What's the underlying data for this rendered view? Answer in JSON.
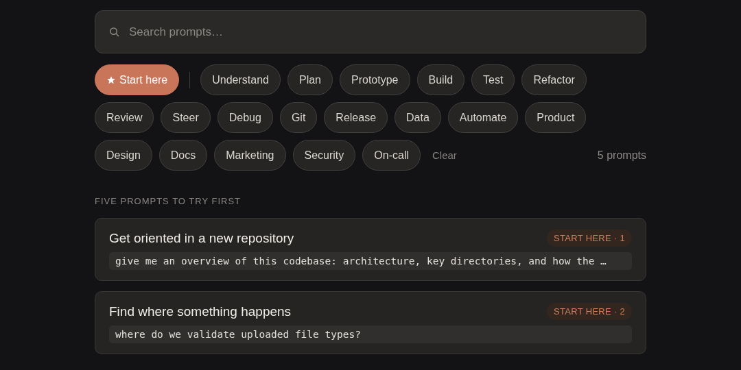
{
  "search": {
    "placeholder": "Search prompts…"
  },
  "filters": [
    {
      "label": "Start here",
      "kind": "featured",
      "selected": true
    },
    {
      "label": "Understand",
      "kind": "category",
      "selected": false
    },
    {
      "label": "Plan",
      "kind": "category",
      "selected": false
    },
    {
      "label": "Prototype",
      "kind": "category",
      "selected": false
    },
    {
      "label": "Build",
      "kind": "category",
      "selected": false
    },
    {
      "label": "Test",
      "kind": "category",
      "selected": false
    },
    {
      "label": "Refactor",
      "kind": "category",
      "selected": false
    },
    {
      "label": "Review",
      "kind": "category",
      "selected": false
    },
    {
      "label": "Steer",
      "kind": "category",
      "selected": false
    },
    {
      "label": "Debug",
      "kind": "category",
      "selected": false
    },
    {
      "label": "Git",
      "kind": "category",
      "selected": false
    },
    {
      "label": "Release",
      "kind": "category",
      "selected": false
    },
    {
      "label": "Data",
      "kind": "category",
      "selected": false
    },
    {
      "label": "Automate",
      "kind": "category",
      "selected": false
    },
    {
      "label": "Product",
      "kind": "category",
      "selected": false
    },
    {
      "label": "Design",
      "kind": "category",
      "selected": false
    },
    {
      "label": "Docs",
      "kind": "category",
      "selected": false
    },
    {
      "label": "Marketing",
      "kind": "category",
      "selected": false
    },
    {
      "label": "Security",
      "kind": "category",
      "selected": false
    },
    {
      "label": "On-call",
      "kind": "category",
      "selected": false
    }
  ],
  "clear_link": "Clear",
  "result_count": "5 prompts",
  "section_heading": "FIVE PROMPTS TO TRY FIRST",
  "prompts": [
    {
      "title": "Get oriented in a new repository",
      "tag": "START HERE · 1",
      "prompt": "give me an overview of this codebase: architecture, key directories, and how the …"
    },
    {
      "title": "Find where something happens",
      "tag": "START HERE · 2",
      "prompt": "where do we validate uploaded file types?"
    }
  ]
}
